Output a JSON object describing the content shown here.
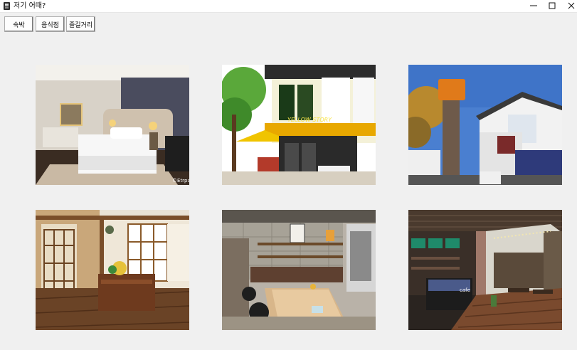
{
  "window": {
    "title": "저기 어때?",
    "accent": "#ffffff"
  },
  "toolbar": {
    "buttons": [
      {
        "label": "숙박"
      },
      {
        "label": "음식점"
      },
      {
        "label": "즐길거리"
      }
    ]
  },
  "gallery": {
    "items": [
      {
        "name": "hotel-room-photo"
      },
      {
        "name": "yellow-cafe-storefront-photo"
      },
      {
        "name": "guesthouse-exterior-photo"
      },
      {
        "name": "hanok-interior-photo"
      },
      {
        "name": "coffee-shop-bar-photo"
      },
      {
        "name": "cafe-terrace-photo"
      }
    ],
    "watermark": "©Etrpa",
    "cafe_sign": "YELLOW STORY",
    "cafe_logo": "cafe"
  }
}
